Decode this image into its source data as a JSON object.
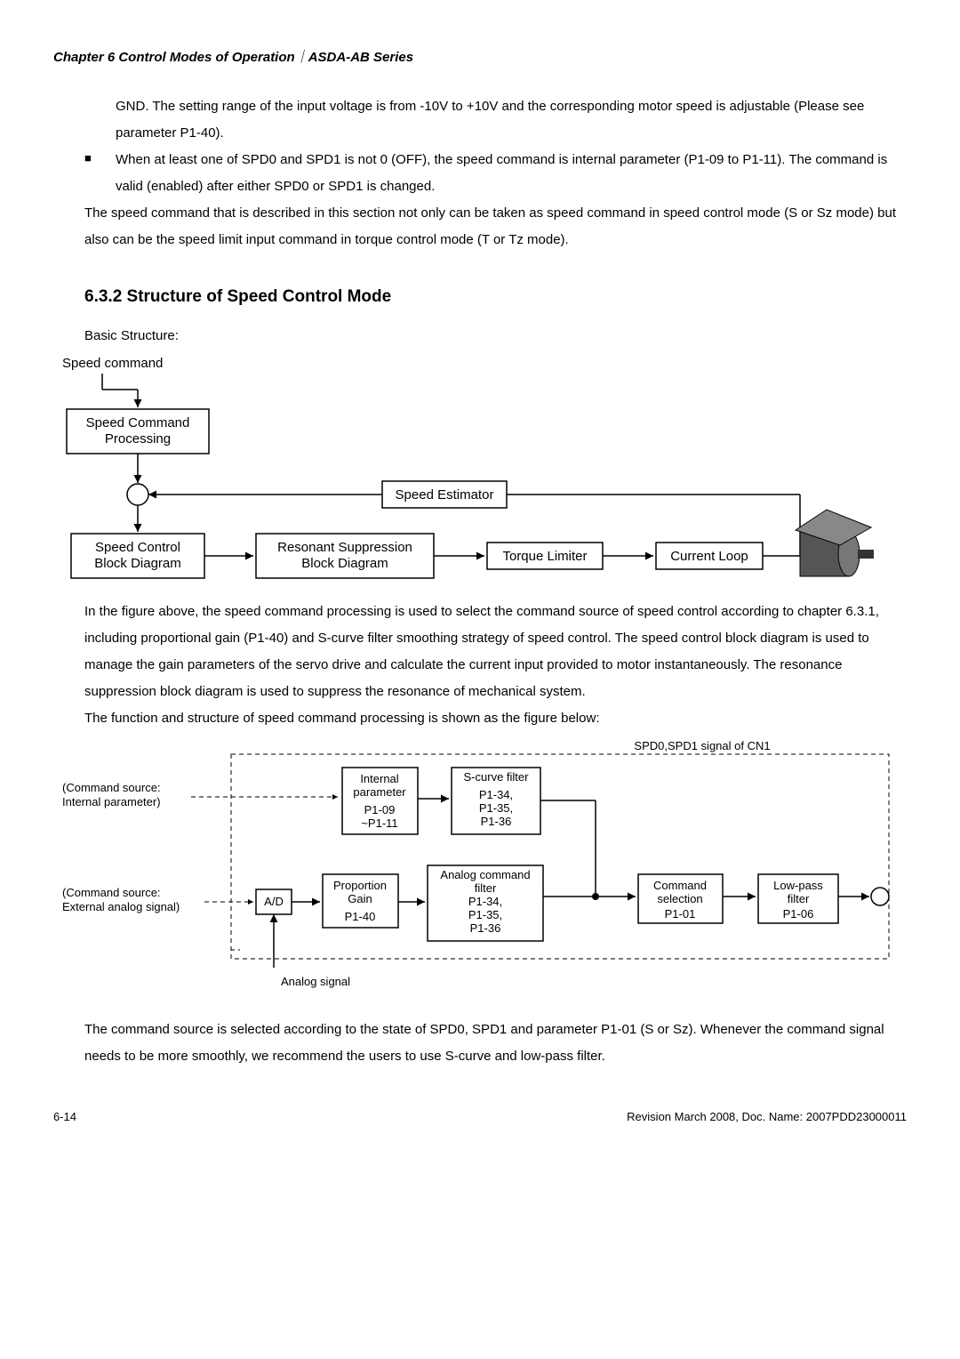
{
  "header": {
    "chapter": "Chapter 6  Control Modes of Operation",
    "sep": "｜",
    "series": "ASDA-AB Series"
  },
  "p1a": "GND. The setting range of the input voltage is from -10V to +10V and the corresponding motor speed is adjustable (Please see parameter P1-40).",
  "bullet1": "When at least one of SPD0 and SPD1 is not 0 (OFF), the speed command is internal parameter (P1-09 to P1-11). The command is valid (enabled) after either SPD0 or SPD1 is changed.",
  "p2": "The speed command that is described in this section not only can be taken as speed command in speed control mode (S or Sz mode) but also can be the speed limit input command in torque control mode (T or Tz mode).",
  "section_title": "6.3.2  Structure of Speed Control Mode",
  "basic_structure": "Basic Structure:",
  "diagram1": {
    "speed_command": "Speed command",
    "proc": "Speed Command\nProcessing",
    "estimator": "Speed Estimator",
    "control": "Speed Control\nBlock Diagram",
    "resonant": "Resonant Suppression\nBlock Diagram",
    "torque": "Torque Limiter",
    "loop": "Current Loop"
  },
  "p3": "In the figure above, the speed command processing is used to select the command source of speed control according to chapter 6.3.1, including proportional gain (P1-40) and S-curve filter smoothing strategy of speed control. The speed control block diagram is used to manage the gain parameters of the servo drive and calculate the current input provided to motor instantaneously. The resonance suppression block diagram is used to suppress the resonance of mechanical system.",
  "p4": "The function and structure of speed command processing is shown as the figure below:",
  "diagram2": {
    "signal_label": "SPD0,SPD1 signal of CN1",
    "src_internal1": "(Command source:",
    "src_internal2": "Internal parameter)",
    "src_ext1": "(Command source:",
    "src_ext2": "External analog signal)",
    "internal_param": "Internal\nparameter\nP1-09\n~P1-11",
    "scurve": "S-curve filter\nP1-34,\nP1-35,\nP1-36",
    "ad": "A/D",
    "prop": "Proportion\nGain\nP1-40",
    "analog_cmd": "Analog command\nfilter\nP1-34,\nP1-35,\nP1-36",
    "cmd_sel": "Command\nselection\nP1-01",
    "lowpass": "Low-pass\nfilter\nP1-06",
    "analog_signal": "Analog signal"
  },
  "p5": "The command source is selected according to the state of SPD0, SPD1 and parameter P1-01 (S or Sz). Whenever the command signal needs to be more smoothly, we recommend the users to use S-curve and low-pass filter.",
  "footer": {
    "page": "6-14",
    "rev": "Revision March 2008, Doc. Name: 2007PDD23000011"
  }
}
